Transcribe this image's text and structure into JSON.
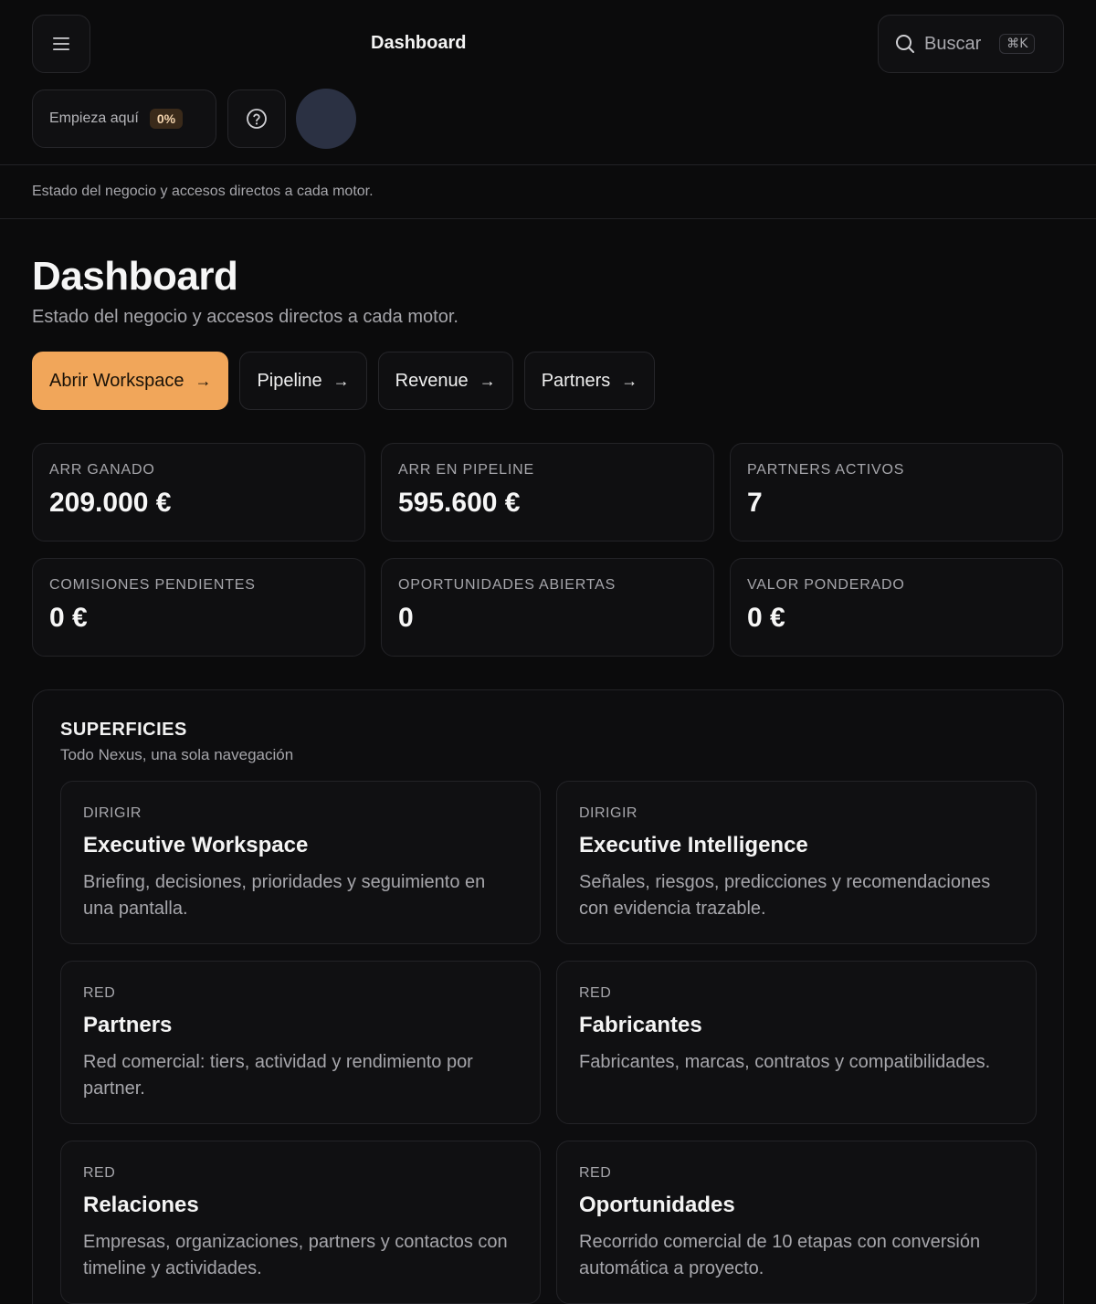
{
  "header": {
    "title": "Dashboard",
    "search_label": "Buscar",
    "search_shortcut": "⌘K",
    "start_label": "Empieza aquí",
    "start_progress": "0%"
  },
  "subbar": {
    "text": "Estado del negocio y accesos directos a cada motor."
  },
  "page": {
    "title": "Dashboard",
    "subtitle": "Estado del negocio y accesos directos a cada motor."
  },
  "actions": [
    {
      "label": "Abrir Workspace",
      "primary": true
    },
    {
      "label": "Pipeline",
      "primary": false
    },
    {
      "label": "Revenue",
      "primary": false
    },
    {
      "label": "Partners",
      "primary": false
    }
  ],
  "metrics": [
    {
      "label": "ARR GANADO",
      "value": "209.000 €"
    },
    {
      "label": "ARR EN PIPELINE",
      "value": "595.600 €"
    },
    {
      "label": "PARTNERS ACTIVOS",
      "value": "7"
    },
    {
      "label": "COMISIONES PENDIENTES",
      "value": "0 €"
    },
    {
      "label": "OPORTUNIDADES ABIERTAS",
      "value": "0"
    },
    {
      "label": "VALOR PONDERADO",
      "value": "0 €"
    }
  ],
  "surfaces": {
    "title": "SUPERFICIES",
    "subtitle": "Todo Nexus, una sola navegación",
    "cards": [
      {
        "tag": "DIRIGIR",
        "title": "Executive Workspace",
        "desc": "Briefing, decisiones, prioridades y seguimiento en una pantalla."
      },
      {
        "tag": "DIRIGIR",
        "title": "Executive Intelligence",
        "desc": "Señales, riesgos, predicciones y recomendaciones con evidencia trazable."
      },
      {
        "tag": "RED",
        "title": "Partners",
        "desc": "Red comercial: tiers, actividad y rendimiento por partner."
      },
      {
        "tag": "RED",
        "title": "Fabricantes",
        "desc": "Fabricantes, marcas, contratos y compatibilidades."
      },
      {
        "tag": "RED",
        "title": "Relaciones",
        "desc": "Empresas, organizaciones, partners y contactos con timeline y actividades."
      },
      {
        "tag": "RED",
        "title": "Oportunidades",
        "desc": "Recorrido comercial de 10 etapas con conversión automática a proyecto."
      }
    ]
  }
}
